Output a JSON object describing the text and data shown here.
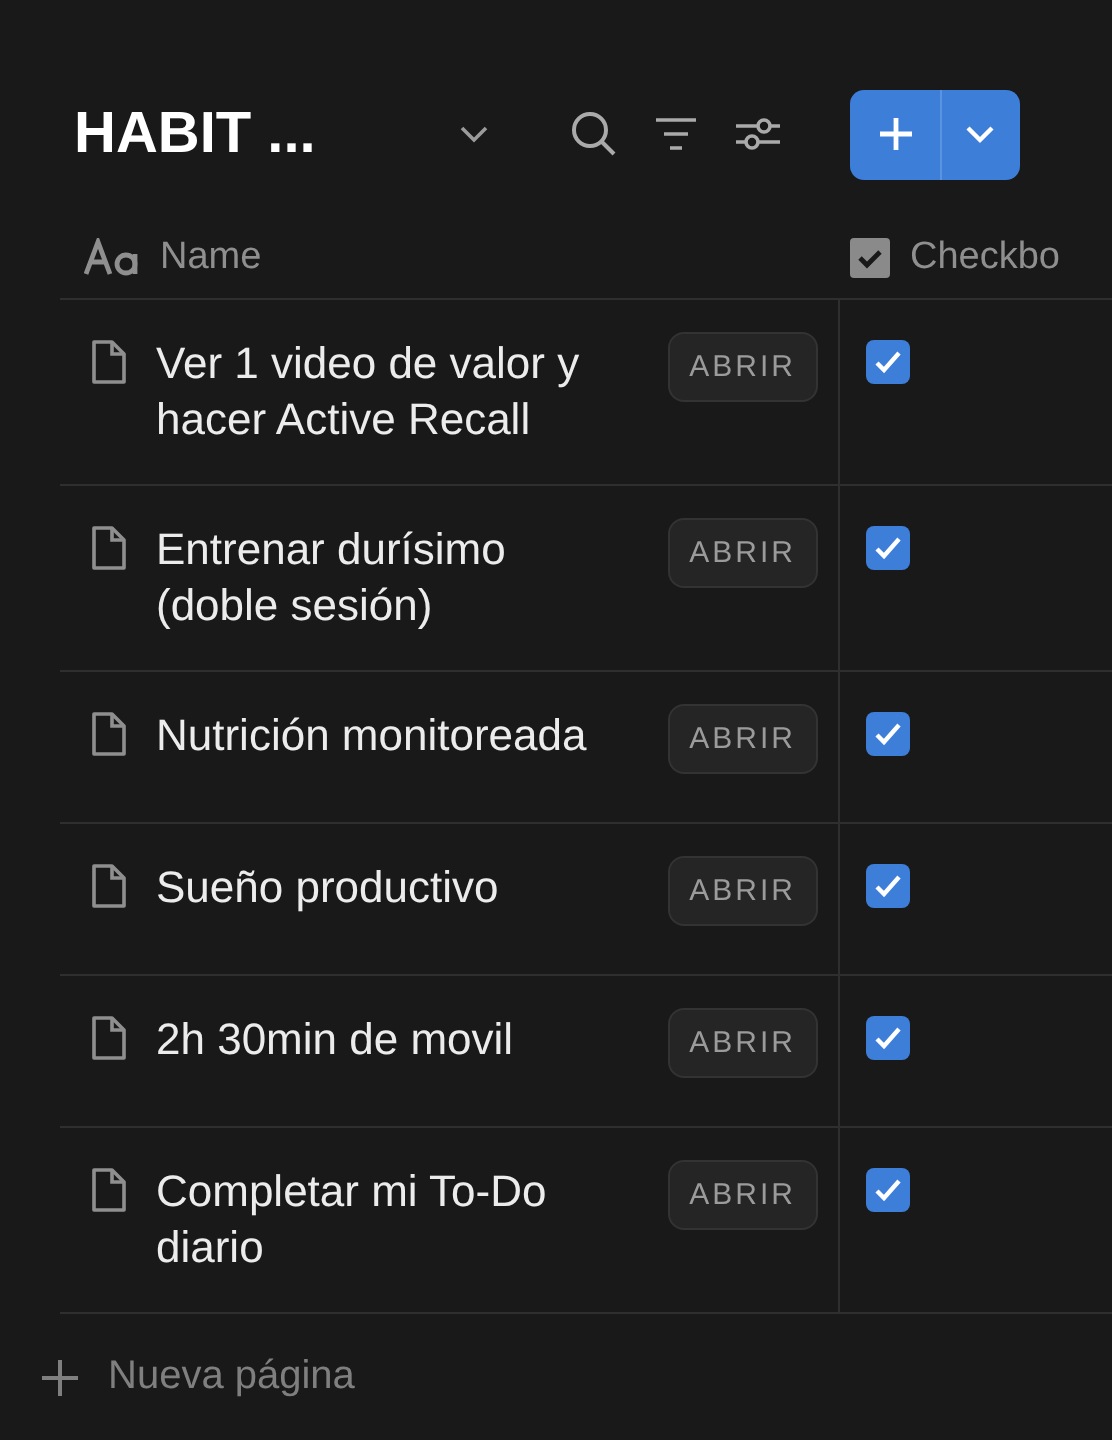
{
  "header": {
    "title": "HABIT ..."
  },
  "table": {
    "columns": [
      {
        "kind": "title",
        "label": "Name"
      },
      {
        "kind": "checkbox",
        "label": "Checkbo"
      }
    ],
    "rows": [
      {
        "name": "Ver 1 video de valor y hacer Active Recall",
        "open_label": "ABRIR",
        "checked": true
      },
      {
        "name": "Entrenar durísimo (doble sesión)",
        "open_label": "ABRIR",
        "checked": true
      },
      {
        "name": "Nutrición monitoreada",
        "open_label": "ABRIR",
        "checked": true
      },
      {
        "name": "Sueño productivo",
        "open_label": "ABRIR",
        "checked": true
      },
      {
        "name": "2h 30min de movil",
        "open_label": "ABRIR",
        "checked": true
      },
      {
        "name": "Completar mi To-Do diario",
        "open_label": "ABRIR",
        "checked": true
      }
    ]
  },
  "new_page": {
    "label": "Nueva página"
  }
}
